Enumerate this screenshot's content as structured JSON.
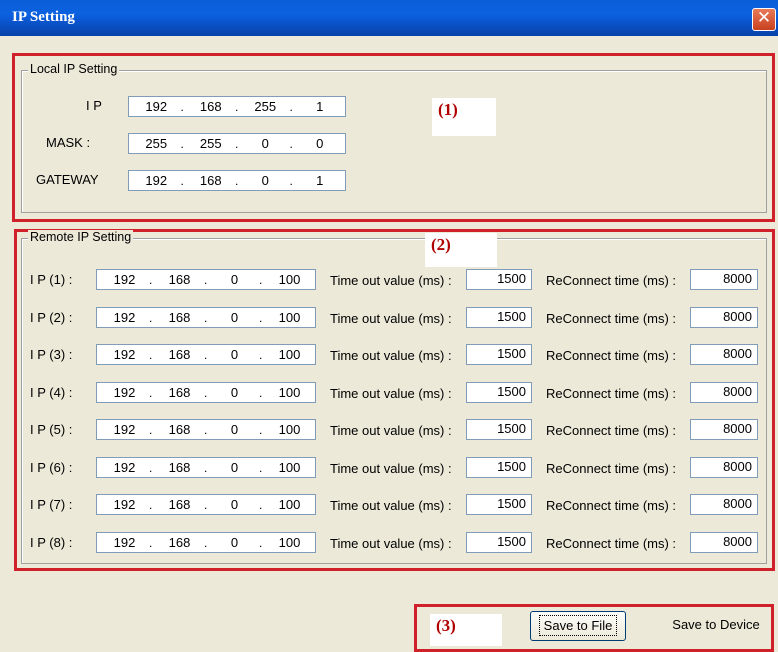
{
  "window": {
    "title": "IP Setting",
    "close_glyph": "✕"
  },
  "local": {
    "legend": "Local IP Setting",
    "fields": [
      {
        "label": "I P",
        "octets": [
          "192",
          "168",
          "255",
          "1"
        ]
      },
      {
        "label": "MASK :",
        "octets": [
          "255",
          "255",
          "0",
          "0"
        ]
      },
      {
        "label": "GATEWAY",
        "octets": [
          "192",
          "168",
          "0",
          "1"
        ]
      }
    ]
  },
  "remote": {
    "legend": "Remote IP Setting",
    "timeout_label": "Time out value (ms) :",
    "reconnect_label": "ReConnect time (ms) :",
    "rows": [
      {
        "label": "I P (1) :",
        "octets": [
          "192",
          "168",
          "0",
          "100"
        ],
        "timeout": "1500",
        "reconnect": "8000"
      },
      {
        "label": "I P (2) :",
        "octets": [
          "192",
          "168",
          "0",
          "100"
        ],
        "timeout": "1500",
        "reconnect": "8000"
      },
      {
        "label": "I P (3) :",
        "octets": [
          "192",
          "168",
          "0",
          "100"
        ],
        "timeout": "1500",
        "reconnect": "8000"
      },
      {
        "label": "I P (4) :",
        "octets": [
          "192",
          "168",
          "0",
          "100"
        ],
        "timeout": "1500",
        "reconnect": "8000"
      },
      {
        "label": "I P (5) :",
        "octets": [
          "192",
          "168",
          "0",
          "100"
        ],
        "timeout": "1500",
        "reconnect": "8000"
      },
      {
        "label": "I P (6) :",
        "octets": [
          "192",
          "168",
          "0",
          "100"
        ],
        "timeout": "1500",
        "reconnect": "8000"
      },
      {
        "label": "I P (7) :",
        "octets": [
          "192",
          "168",
          "0",
          "100"
        ],
        "timeout": "1500",
        "reconnect": "8000"
      },
      {
        "label": "I P (8) :",
        "octets": [
          "192",
          "168",
          "0",
          "100"
        ],
        "timeout": "1500",
        "reconnect": "8000"
      }
    ]
  },
  "annotations": {
    "one": "(1)",
    "two": "(2)",
    "three": "(3)"
  },
  "buttons": {
    "save_file": "Save to File",
    "save_device": "Save to Device"
  },
  "colors": {
    "annotation_red": "#d0202a",
    "titlebar_blue": "#0a5fd8"
  },
  "icons": {
    "close": "close-icon"
  }
}
